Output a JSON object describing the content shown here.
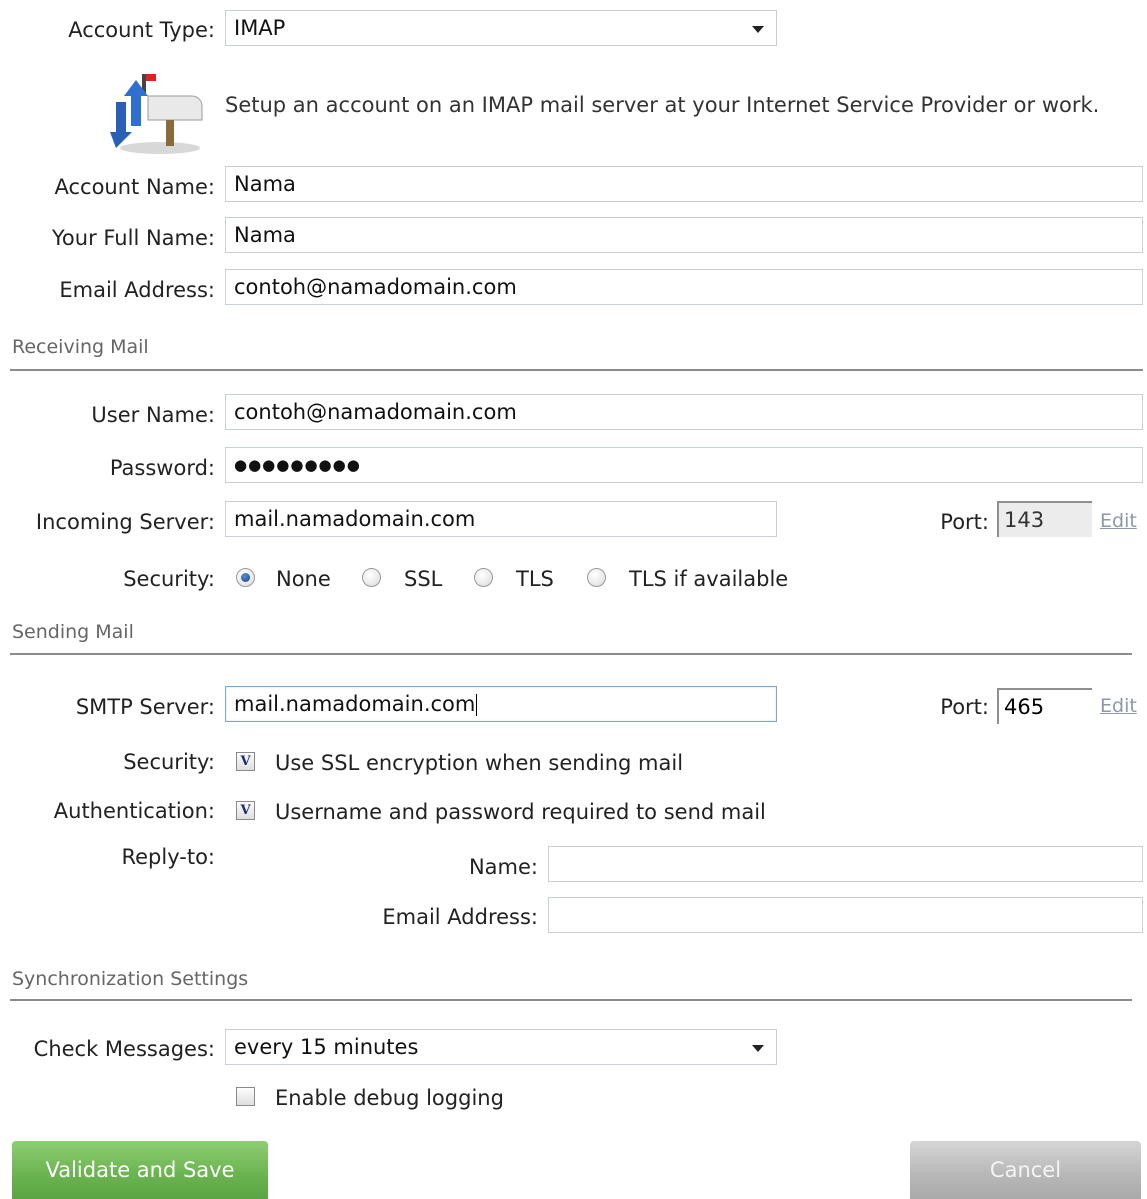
{
  "account": {
    "type_label": "Account Type:",
    "type_value": "IMAP",
    "description": "Setup an account on an IMAP mail server at your Internet Service Provider or work.",
    "icon": "mailbox-sync-icon",
    "name_label": "Account Name:",
    "name_value": "Nama",
    "fullname_label": "Your Full Name:",
    "fullname_value": "Nama",
    "email_label": "Email Address:",
    "email_value": "contoh@namadomain.com"
  },
  "receiving": {
    "section_title": "Receiving Mail",
    "username_label": "User Name:",
    "username_value": "contoh@namadomain.com",
    "password_label": "Password:",
    "password_value": "●●●●●●●●●",
    "server_label": "Incoming Server:",
    "server_value": "mail.namadomain.com",
    "port_label": "Port:",
    "port_value": "143",
    "edit_label": "Edit",
    "security_label": "Security:",
    "security_options": [
      "None",
      "SSL",
      "TLS",
      "TLS if available"
    ],
    "security_selected": "None"
  },
  "sending": {
    "section_title": "Sending Mail",
    "smtp_label": "SMTP Server:",
    "smtp_value": "mail.namadomain.com",
    "port_label": "Port:",
    "port_value": "465",
    "edit_label": "Edit",
    "security_label": "Security:",
    "ssl_checkbox_mark": "V",
    "ssl_checkbox_label": "Use SSL encryption when sending mail",
    "auth_label": "Authentication:",
    "auth_checkbox_mark": "V",
    "auth_checkbox_label": "Username and password required to send mail",
    "replyto_label": "Reply-to:",
    "replyto_name_label": "Name:",
    "replyto_name_value": "",
    "replyto_email_label": "Email Address:",
    "replyto_email_value": ""
  },
  "sync": {
    "section_title": "Synchronization Settings",
    "check_label": "Check Messages:",
    "check_value": "every 15 minutes",
    "debug_label": "Enable debug logging",
    "debug_checked": false
  },
  "buttons": {
    "validate_label": "Validate and Save",
    "cancel_label": "Cancel"
  },
  "colors": {
    "validate_button": "#6cb552",
    "cancel_button": "#b9b9b9",
    "section_text": "#666666"
  }
}
